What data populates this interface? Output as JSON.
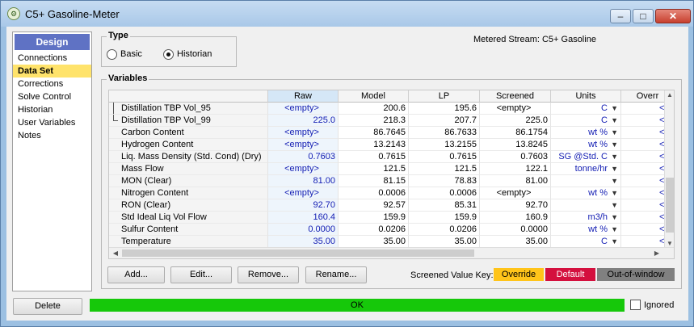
{
  "window": {
    "title": "C5+ Gasoline-Meter",
    "minimize_glyph": "–",
    "maximize_glyph": "□",
    "close_glyph": "✕"
  },
  "nav": {
    "header": "Design",
    "items": [
      {
        "label": "Connections",
        "active": false
      },
      {
        "label": "Data Set",
        "active": true
      },
      {
        "label": "Corrections",
        "active": false
      },
      {
        "label": "Solve Control",
        "active": false
      },
      {
        "label": "Historian",
        "active": false
      },
      {
        "label": "User Variables",
        "active": false
      },
      {
        "label": "Notes",
        "active": false
      }
    ]
  },
  "type_group": {
    "label": "Type",
    "options": [
      {
        "label": "Basic",
        "selected": false
      },
      {
        "label": "Historian",
        "selected": true
      }
    ]
  },
  "metered_stream": "Metered Stream: C5+ Gasoline",
  "variables": {
    "label": "Variables",
    "columns": [
      "",
      "Raw",
      "Model",
      "LP",
      "Screened",
      "Units",
      "Overr"
    ],
    "rows": [
      {
        "name": "Distillation TBP Vol_95",
        "raw": "<empty>",
        "model": "200.6",
        "lp": "195.6",
        "screened": "<empty>",
        "units": "C",
        "override": "<er"
      },
      {
        "name": "Distillation TBP Vol_99",
        "raw": "225.0",
        "model": "218.3",
        "lp": "207.7",
        "screened": "225.0",
        "units": "C",
        "override": "<er"
      },
      {
        "name": "Carbon Content",
        "raw": "<empty>",
        "model": "86.7645",
        "lp": "86.7633",
        "screened": "86.1754",
        "units": "wt %",
        "override": "<er"
      },
      {
        "name": "Hydrogen Content",
        "raw": "<empty>",
        "model": "13.2143",
        "lp": "13.2155",
        "screened": "13.8245",
        "units": "wt %",
        "override": "<er"
      },
      {
        "name": "Liq. Mass Density (Std. Cond) (Dry)",
        "raw": "0.7603",
        "model": "0.7615",
        "lp": "0.7615",
        "screened": "0.7603",
        "units": "SG @Std. C",
        "override": "<er"
      },
      {
        "name": "Mass Flow",
        "raw": "<empty>",
        "model": "121.5",
        "lp": "121.5",
        "screened": "122.1",
        "units": "tonne/hr",
        "override": "<er"
      },
      {
        "name": "MON (Clear)",
        "raw": "81.00",
        "model": "81.15",
        "lp": "78.83",
        "screened": "81.00",
        "units": "",
        "override": "<er"
      },
      {
        "name": "Nitrogen Content",
        "raw": "<empty>",
        "model": "0.0006",
        "lp": "0.0006",
        "screened": "<empty>",
        "units": "wt %",
        "override": "<er"
      },
      {
        "name": "RON (Clear)",
        "raw": "92.70",
        "model": "92.57",
        "lp": "85.31",
        "screened": "92.70",
        "units": "",
        "override": "<er"
      },
      {
        "name": "Std Ideal Liq Vol Flow",
        "raw": "160.4",
        "model": "159.9",
        "lp": "159.9",
        "screened": "160.9",
        "units": "m3/h",
        "override": "<er"
      },
      {
        "name": "Sulfur Content",
        "raw": "0.0000",
        "model": "0.0206",
        "lp": "0.0206",
        "screened": "0.0000",
        "units": "wt %",
        "override": "<er"
      },
      {
        "name": "Temperature",
        "raw": "35.00",
        "model": "35.00",
        "lp": "35.00",
        "screened": "35.00",
        "units": "C",
        "override": "<er"
      }
    ]
  },
  "buttons": {
    "add": "Add...",
    "edit": "Edit...",
    "remove": "Remove...",
    "rename": "Rename..."
  },
  "screened_key": {
    "label": "Screened Value Key:",
    "override": "Override",
    "default": "Default",
    "out_of_window": "Out-of-window",
    "colors": {
      "override": "#ffc41a",
      "default": "#d4103e",
      "out_of_window": "#808080"
    }
  },
  "bottom": {
    "delete": "Delete",
    "status": "OK",
    "status_color": "#16c80a",
    "ignored_label": "Ignored",
    "ignored_checked": false
  }
}
